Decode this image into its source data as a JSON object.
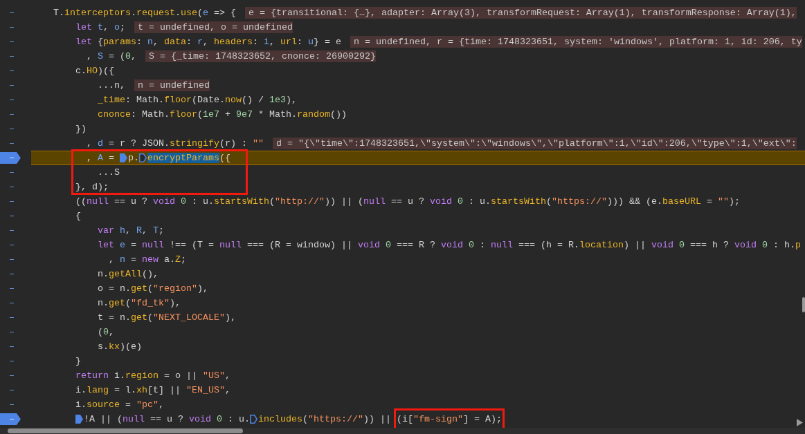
{
  "editor": {
    "lines": [
      {
        "marker": "–",
        "breakpoint": false,
        "paused": false,
        "code": [
          {
            "kind": "txt",
            "text": "T."
          },
          {
            "kind": "prop",
            "text": "interceptors"
          },
          {
            "kind": "txt",
            "text": "."
          },
          {
            "kind": "prop",
            "text": "request"
          },
          {
            "kind": "txt",
            "text": "."
          },
          {
            "kind": "prop",
            "text": "use"
          },
          {
            "kind": "txt",
            "text": "("
          },
          {
            "kind": "var",
            "text": "e"
          },
          {
            "kind": "txt",
            "text": " => {"
          }
        ],
        "value": "e = {transitional: {…}, adapter: Array(3), transformRequest: Array(1), transformResponse: Array(1),"
      },
      {
        "marker": "–",
        "breakpoint": false,
        "paused": false,
        "code": [
          {
            "kind": "kw",
            "text": "    let "
          },
          {
            "kind": "var",
            "text": "t"
          },
          {
            "kind": "txt",
            "text": ", "
          },
          {
            "kind": "var",
            "text": "o"
          },
          {
            "kind": "txt",
            "text": ";"
          }
        ],
        "value": "t = undefined, o = undefined"
      },
      {
        "marker": "–",
        "breakpoint": false,
        "paused": false,
        "code": [
          {
            "kind": "kw",
            "text": "    let"
          },
          {
            "kind": "txt",
            "text": " {"
          },
          {
            "kind": "prop",
            "text": "params"
          },
          {
            "kind": "txt",
            "text": ": "
          },
          {
            "kind": "var",
            "text": "n"
          },
          {
            "kind": "txt",
            "text": ", "
          },
          {
            "kind": "prop",
            "text": "data"
          },
          {
            "kind": "txt",
            "text": ": "
          },
          {
            "kind": "var",
            "text": "r"
          },
          {
            "kind": "txt",
            "text": ", "
          },
          {
            "kind": "prop",
            "text": "headers"
          },
          {
            "kind": "txt",
            "text": ": "
          },
          {
            "kind": "var",
            "text": "i"
          },
          {
            "kind": "txt",
            "text": ", "
          },
          {
            "kind": "prop",
            "text": "url"
          },
          {
            "kind": "txt",
            "text": ": "
          },
          {
            "kind": "var",
            "text": "u"
          },
          {
            "kind": "txt",
            "text": "} = e"
          }
        ],
        "value": "n = undefined, r = {time: 1748323651, system: 'windows', platform: 1, id: 206, ty"
      },
      {
        "marker": "–",
        "breakpoint": false,
        "paused": false,
        "code": [
          {
            "kind": "txt",
            "text": "      , "
          },
          {
            "kind": "var",
            "text": "S"
          },
          {
            "kind": "txt",
            "text": " = ("
          },
          {
            "kind": "num",
            "text": "0"
          },
          {
            "kind": "txt",
            "text": ","
          }
        ],
        "value": "S = {_time: 1748323652, cnonce: 26900292}"
      },
      {
        "marker": "–",
        "breakpoint": false,
        "paused": false,
        "code": [
          {
            "kind": "txt",
            "text": "    c."
          },
          {
            "kind": "prop",
            "text": "HO"
          },
          {
            "kind": "txt",
            "text": ")({"
          }
        ]
      },
      {
        "marker": "–",
        "breakpoint": false,
        "paused": false,
        "code": [
          {
            "kind": "txt",
            "text": "        ...n,"
          }
        ],
        "value": "n = undefined"
      },
      {
        "marker": "–",
        "breakpoint": false,
        "paused": false,
        "code": [
          {
            "kind": "prop",
            "text": "        _time"
          },
          {
            "kind": "txt",
            "text": ": Math."
          },
          {
            "kind": "prop",
            "text": "floor"
          },
          {
            "kind": "txt",
            "text": "(Date."
          },
          {
            "kind": "prop",
            "text": "now"
          },
          {
            "kind": "txt",
            "text": "() / "
          },
          {
            "kind": "num",
            "text": "1e3"
          },
          {
            "kind": "txt",
            "text": "),"
          }
        ]
      },
      {
        "marker": "–",
        "breakpoint": false,
        "paused": false,
        "code": [
          {
            "kind": "prop",
            "text": "        cnonce"
          },
          {
            "kind": "txt",
            "text": ": Math."
          },
          {
            "kind": "prop",
            "text": "floor"
          },
          {
            "kind": "txt",
            "text": "("
          },
          {
            "kind": "num",
            "text": "1e7"
          },
          {
            "kind": "txt",
            "text": " + "
          },
          {
            "kind": "num",
            "text": "9e7"
          },
          {
            "kind": "txt",
            "text": " * Math."
          },
          {
            "kind": "prop",
            "text": "random"
          },
          {
            "kind": "txt",
            "text": "())"
          }
        ]
      },
      {
        "marker": "–",
        "breakpoint": false,
        "paused": false,
        "code": [
          {
            "kind": "txt",
            "text": "    })"
          }
        ]
      },
      {
        "marker": "–",
        "breakpoint": false,
        "paused": false,
        "code": [
          {
            "kind": "txt",
            "text": "      , "
          },
          {
            "kind": "var",
            "text": "d"
          },
          {
            "kind": "txt",
            "text": " = r ? JSON."
          },
          {
            "kind": "prop",
            "text": "stringify"
          },
          {
            "kind": "txt",
            "text": "(r) : "
          },
          {
            "kind": "str",
            "text": "\"\""
          }
        ],
        "value": "d = \"{\\\"time\\\":1748323651,\\\"system\\\":\\\"windows\\\",\\\"platform\\\":1,\\\"id\\\":206,\\\"type\\\":1,\\\"ext\\\":"
      },
      {
        "marker": "–",
        "breakpoint": true,
        "paused": true,
        "code": [
          {
            "kind": "txt",
            "text": "      , "
          },
          {
            "kind": "var",
            "text": "A"
          },
          {
            "kind": "txt",
            "text": " = "
          },
          {
            "kind": "txt",
            "text": "p.",
            "inline_breakpoint": true,
            "active": true
          },
          {
            "kind": "sel",
            "text": "encryptParams",
            "inline_breakpoint": true,
            "active": false
          },
          {
            "kind": "txt",
            "text": "({"
          }
        ]
      },
      {
        "marker": "–",
        "breakpoint": false,
        "paused": false,
        "code": [
          {
            "kind": "txt",
            "text": "        ...S"
          }
        ]
      },
      {
        "marker": "–",
        "breakpoint": false,
        "paused": false,
        "code": [
          {
            "kind": "txt",
            "text": "    }, d);"
          }
        ]
      },
      {
        "marker": "–",
        "breakpoint": false,
        "paused": false,
        "code": [
          {
            "kind": "txt",
            "text": "    (("
          },
          {
            "kind": "kw",
            "text": "null"
          },
          {
            "kind": "txt",
            "text": " == u ? "
          },
          {
            "kind": "kw",
            "text": "void "
          },
          {
            "kind": "num",
            "text": "0"
          },
          {
            "kind": "txt",
            "text": " : u."
          },
          {
            "kind": "prop",
            "text": "startsWith"
          },
          {
            "kind": "txt",
            "text": "("
          },
          {
            "kind": "str",
            "text": "\"http://\""
          },
          {
            "kind": "txt",
            "text": ")) || ("
          },
          {
            "kind": "kw",
            "text": "null"
          },
          {
            "kind": "txt",
            "text": " == u ? "
          },
          {
            "kind": "kw",
            "text": "void "
          },
          {
            "kind": "num",
            "text": "0"
          },
          {
            "kind": "txt",
            "text": " : u."
          },
          {
            "kind": "prop",
            "text": "startsWith"
          },
          {
            "kind": "txt",
            "text": "("
          },
          {
            "kind": "str",
            "text": "\"https://\""
          },
          {
            "kind": "txt",
            "text": "))) && (e."
          },
          {
            "kind": "prop",
            "text": "baseURL"
          },
          {
            "kind": "txt",
            "text": " = "
          },
          {
            "kind": "str",
            "text": "\"\""
          },
          {
            "kind": "txt",
            "text": ");"
          }
        ]
      },
      {
        "marker": "–",
        "breakpoint": false,
        "paused": false,
        "code": [
          {
            "kind": "txt",
            "text": "    {"
          }
        ]
      },
      {
        "marker": "–",
        "breakpoint": false,
        "paused": false,
        "code": [
          {
            "kind": "kw",
            "text": "        var "
          },
          {
            "kind": "var",
            "text": "h"
          },
          {
            "kind": "txt",
            "text": ", "
          },
          {
            "kind": "var",
            "text": "R"
          },
          {
            "kind": "txt",
            "text": ", "
          },
          {
            "kind": "var",
            "text": "T"
          },
          {
            "kind": "txt",
            "text": ";"
          }
        ]
      },
      {
        "marker": "–",
        "breakpoint": false,
        "paused": false,
        "code": [
          {
            "kind": "kw",
            "text": "        let "
          },
          {
            "kind": "var",
            "text": "e"
          },
          {
            "kind": "txt",
            "text": " = "
          },
          {
            "kind": "kw",
            "text": "null"
          },
          {
            "kind": "txt",
            "text": " !== (T = "
          },
          {
            "kind": "kw",
            "text": "null"
          },
          {
            "kind": "txt",
            "text": " === (R = window) || "
          },
          {
            "kind": "kw",
            "text": "void "
          },
          {
            "kind": "num",
            "text": "0"
          },
          {
            "kind": "txt",
            "text": " === R ? "
          },
          {
            "kind": "kw",
            "text": "void "
          },
          {
            "kind": "num",
            "text": "0"
          },
          {
            "kind": "txt",
            "text": " : "
          },
          {
            "kind": "kw",
            "text": "null"
          },
          {
            "kind": "txt",
            "text": " === (h = R."
          },
          {
            "kind": "prop",
            "text": "location"
          },
          {
            "kind": "txt",
            "text": ") || "
          },
          {
            "kind": "kw",
            "text": "void "
          },
          {
            "kind": "num",
            "text": "0"
          },
          {
            "kind": "txt",
            "text": " === h ? "
          },
          {
            "kind": "kw",
            "text": "void "
          },
          {
            "kind": "num",
            "text": "0"
          },
          {
            "kind": "txt",
            "text": " : h."
          },
          {
            "kind": "prop",
            "text": "p"
          }
        ]
      },
      {
        "marker": "–",
        "breakpoint": false,
        "paused": false,
        "code": [
          {
            "kind": "txt",
            "text": "          , "
          },
          {
            "kind": "var",
            "text": "n"
          },
          {
            "kind": "txt",
            "text": " = "
          },
          {
            "kind": "kw",
            "text": "new"
          },
          {
            "kind": "txt",
            "text": " a."
          },
          {
            "kind": "prop",
            "text": "Z"
          },
          {
            "kind": "txt",
            "text": ";"
          }
        ]
      },
      {
        "marker": "–",
        "breakpoint": false,
        "paused": false,
        "code": [
          {
            "kind": "txt",
            "text": "        n."
          },
          {
            "kind": "prop",
            "text": "getAll"
          },
          {
            "kind": "txt",
            "text": "(),"
          }
        ]
      },
      {
        "marker": "–",
        "breakpoint": false,
        "paused": false,
        "code": [
          {
            "kind": "txt",
            "text": "        o = n."
          },
          {
            "kind": "prop",
            "text": "get"
          },
          {
            "kind": "txt",
            "text": "("
          },
          {
            "kind": "str",
            "text": "\"region\""
          },
          {
            "kind": "txt",
            "text": "),"
          }
        ]
      },
      {
        "marker": "–",
        "breakpoint": false,
        "paused": false,
        "code": [
          {
            "kind": "txt",
            "text": "        n."
          },
          {
            "kind": "prop",
            "text": "get"
          },
          {
            "kind": "txt",
            "text": "("
          },
          {
            "kind": "str",
            "text": "\"fd_tk\""
          },
          {
            "kind": "txt",
            "text": "),"
          }
        ]
      },
      {
        "marker": "–",
        "breakpoint": false,
        "paused": false,
        "code": [
          {
            "kind": "txt",
            "text": "        t = n."
          },
          {
            "kind": "prop",
            "text": "get"
          },
          {
            "kind": "txt",
            "text": "("
          },
          {
            "kind": "str",
            "text": "\"NEXT_LOCALE\""
          },
          {
            "kind": "txt",
            "text": "),"
          }
        ]
      },
      {
        "marker": "–",
        "breakpoint": false,
        "paused": false,
        "code": [
          {
            "kind": "txt",
            "text": "        ("
          },
          {
            "kind": "num",
            "text": "0"
          },
          {
            "kind": "txt",
            "text": ","
          }
        ]
      },
      {
        "marker": "–",
        "breakpoint": false,
        "paused": false,
        "code": [
          {
            "kind": "txt",
            "text": "        s."
          },
          {
            "kind": "prop",
            "text": "kx"
          },
          {
            "kind": "txt",
            "text": ")(e)"
          }
        ]
      },
      {
        "marker": "–",
        "breakpoint": false,
        "paused": false,
        "code": [
          {
            "kind": "txt",
            "text": "    }"
          }
        ]
      },
      {
        "marker": "–",
        "breakpoint": false,
        "paused": false,
        "code": [
          {
            "kind": "kw",
            "text": "    return"
          },
          {
            "kind": "txt",
            "text": " i."
          },
          {
            "kind": "prop",
            "text": "region"
          },
          {
            "kind": "txt",
            "text": " = o || "
          },
          {
            "kind": "str",
            "text": "\"US\""
          },
          {
            "kind": "txt",
            "text": ","
          }
        ]
      },
      {
        "marker": "–",
        "breakpoint": false,
        "paused": false,
        "code": [
          {
            "kind": "txt",
            "text": "    i."
          },
          {
            "kind": "prop",
            "text": "lang"
          },
          {
            "kind": "txt",
            "text": " = l."
          },
          {
            "kind": "prop",
            "text": "xh"
          },
          {
            "kind": "txt",
            "text": "[t] || "
          },
          {
            "kind": "str",
            "text": "\"EN_US\""
          },
          {
            "kind": "txt",
            "text": ","
          }
        ]
      },
      {
        "marker": "–",
        "breakpoint": false,
        "paused": false,
        "code": [
          {
            "kind": "txt",
            "text": "    i."
          },
          {
            "kind": "prop",
            "text": "source"
          },
          {
            "kind": "txt",
            "text": " = "
          },
          {
            "kind": "str",
            "text": "\"pc\""
          },
          {
            "kind": "txt",
            "text": ","
          }
        ]
      },
      {
        "marker": "–",
        "breakpoint": true,
        "paused": false,
        "code": [
          {
            "kind": "txt",
            "text": "    !A || (",
            "inline_breakpoint": true,
            "active": true
          },
          {
            "kind": "kw",
            "text": "null"
          },
          {
            "kind": "txt",
            "text": " == u ? "
          },
          {
            "kind": "kw",
            "text": "void "
          },
          {
            "kind": "num",
            "text": "0"
          },
          {
            "kind": "txt",
            "text": " : u."
          },
          {
            "kind": "prop",
            "text": "includes",
            "inline_breakpoint": true,
            "active": false
          },
          {
            "kind": "txt",
            "text": "("
          },
          {
            "kind": "str",
            "text": "\"https://\""
          },
          {
            "kind": "txt",
            "text": ")) || "
          },
          {
            "kind": "txt",
            "text": "(i[",
            "boxed": true
          },
          {
            "kind": "str",
            "text": "\"fm-sign\"",
            "boxed": true
          },
          {
            "kind": "txt",
            "text": "] = A);",
            "boxed": true
          }
        ]
      }
    ],
    "annotations": [
      {
        "kind": "box"
      }
    ]
  }
}
